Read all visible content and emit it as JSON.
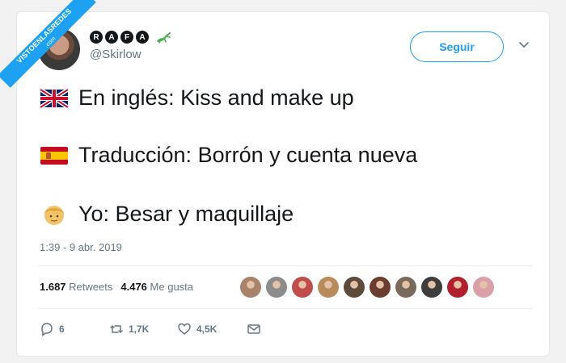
{
  "watermark": {
    "text": "VISTOENLASREDES",
    "sub": ".com"
  },
  "tweet": {
    "display_name_letters": [
      "R",
      "A",
      "F",
      "A"
    ],
    "handle": "@Skirlow",
    "follow_label": "Seguir",
    "lines": [
      {
        "emoji": "uk-flag-icon",
        "text": "En inglés: Kiss and make up"
      },
      {
        "emoji": "spain-flag-icon",
        "text": "Traducción: Borrón y cuenta nueva"
      },
      {
        "emoji": "blond-person-icon",
        "text": "Yo: Besar y maquillaje"
      }
    ],
    "timestamp": "1:39 - 9 abr. 2019",
    "stats": {
      "retweets_count": "1.687",
      "retweets_label": "Retweets",
      "likes_count": "4.476",
      "likes_label": "Me gusta"
    },
    "liker_avatar_colors": [
      "#a8836a",
      "#8c8c8c",
      "#c24b4b",
      "#b88a5c",
      "#5c4a3a",
      "#6b3d2e",
      "#7a6a5c",
      "#3d3d3d",
      "#b2202e",
      "#d9a0a8"
    ],
    "actions": {
      "replies": "6",
      "retweets": "1,7K",
      "likes": "4,5K"
    }
  },
  "colors": {
    "brand": "#1da1f2",
    "muted": "#657786"
  }
}
